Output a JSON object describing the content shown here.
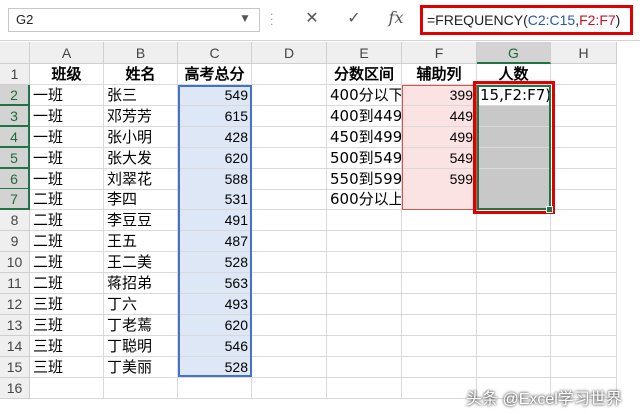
{
  "formula_bar": {
    "name_box": "G2",
    "cancel_icon": "✕",
    "enter_icon": "✓",
    "fx_label": "fx",
    "formula_parts": [
      {
        "text": "=FREQUENCY(",
        "color": "#222222"
      },
      {
        "text": "C2:C15",
        "color": "#2457b8"
      },
      {
        "text": ",",
        "color": "#222222"
      },
      {
        "text": "F2:F7",
        "color": "#c0142c"
      },
      {
        "text": ")",
        "color": "#222222"
      }
    ]
  },
  "columns": [
    "A",
    "B",
    "C",
    "D",
    "E",
    "F",
    "G",
    "H"
  ],
  "rows": [
    [
      "班级",
      "姓名",
      "高考总分",
      "",
      "分数区间",
      "辅助列",
      "人数",
      ""
    ],
    [
      "一班",
      "张三",
      "549",
      "",
      "400分以下",
      "399",
      "15,F2:F7)",
      ""
    ],
    [
      "一班",
      "邓芳芳",
      "615",
      "",
      "400到449",
      "449",
      "",
      ""
    ],
    [
      "一班",
      "张小明",
      "428",
      "",
      "450到499",
      "499",
      "",
      ""
    ],
    [
      "一班",
      "张大发",
      "620",
      "",
      "500到549",
      "549",
      "",
      ""
    ],
    [
      "一班",
      "刘翠花",
      "588",
      "",
      "550到599",
      "599",
      "",
      ""
    ],
    [
      "二班",
      "李四",
      "531",
      "",
      "600分以上",
      "",
      "",
      ""
    ],
    [
      "二班",
      "李豆豆",
      "491",
      "",
      "",
      "",
      "",
      ""
    ],
    [
      "二班",
      "王五",
      "487",
      "",
      "",
      "",
      "",
      ""
    ],
    [
      "二班",
      "王二美",
      "528",
      "",
      "",
      "",
      "",
      ""
    ],
    [
      "二班",
      "蒋招弟",
      "563",
      "",
      "",
      "",
      "",
      ""
    ],
    [
      "三班",
      "丁六",
      "493",
      "",
      "",
      "",
      "",
      ""
    ],
    [
      "三班",
      "丁老蔫",
      "620",
      "",
      "",
      "",
      "",
      ""
    ],
    [
      "三班",
      "丁聪明",
      "546",
      "",
      "",
      "",
      "",
      ""
    ],
    [
      "三班",
      "丁美丽",
      "528",
      "",
      "",
      "",
      "",
      ""
    ]
  ],
  "colors": {
    "range_c": "#4472c4",
    "range_f": "#d9534f",
    "selection": "#217346",
    "highlight_box": "#e00000"
  },
  "watermark": "头条 @Excel学习世界"
}
